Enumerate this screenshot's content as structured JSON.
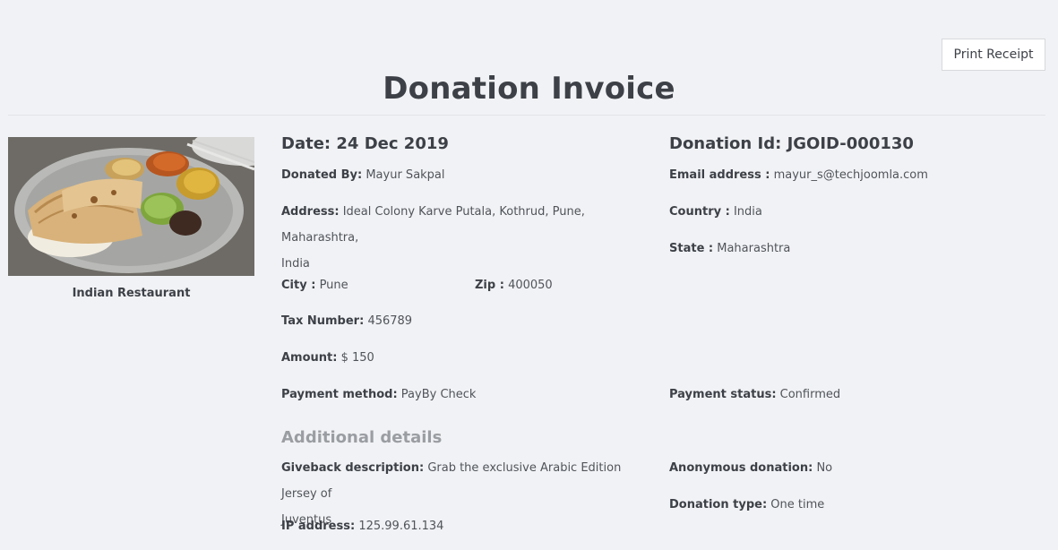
{
  "toolbar": {
    "print_label": "Print Receipt"
  },
  "invoice": {
    "title": "Donation Invoice"
  },
  "campaign": {
    "name": "Indian Restaurant"
  },
  "details": {
    "date_label": "Date:",
    "date_value": "24 Dec 2019",
    "donation_id_label": "Donation Id:",
    "donation_id_value": "JGOID-000130",
    "donated_by_label": "Donated By:",
    "donated_by_value": "Mayur Sakpal",
    "email_label": "Email address :",
    "email_value": "mayur_s@techjoomla.com",
    "address_label": "Address:",
    "address_value_line1": "Ideal Colony Karve Putala, Kothrud, Pune, Maharashtra,",
    "address_value_line2": "India",
    "country_label": "Country :",
    "country_value": "India",
    "state_label": "State :",
    "state_value": "Maharashtra",
    "city_label": "City :",
    "city_value": "Pune",
    "zip_label": "Zip :",
    "zip_value": "400050",
    "tax_label": "Tax Number:",
    "tax_value": "456789",
    "amount_label": "Amount:",
    "amount_value": "$ 150",
    "payment_method_label": "Payment method:",
    "payment_method_value": "PayBy Check",
    "payment_status_label": "Payment status:",
    "payment_status_value": "Confirmed"
  },
  "additional": {
    "heading": "Additional details",
    "giveback_label": "Giveback description:",
    "giveback_value_line1": "Grab the exclusive Arabic Edition Jersey of",
    "giveback_value_line2": "Juventus",
    "anonymous_label": "Anonymous donation:",
    "anonymous_value": "No",
    "donation_type_label": "Donation type:",
    "donation_type_value": "One time",
    "ip_label": "IP address:",
    "ip_value": "125.99.61.134"
  }
}
